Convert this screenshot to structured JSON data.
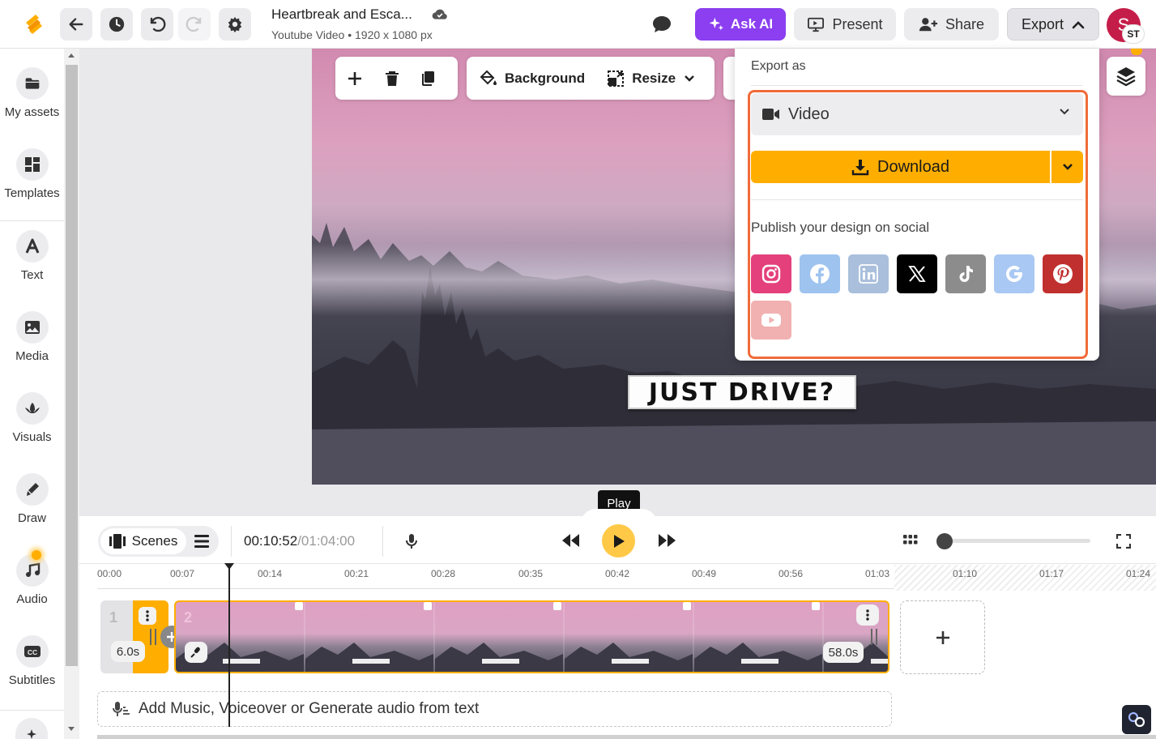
{
  "header": {
    "doc_title": "Heartbreak and Esca...",
    "doc_subtitle": "Youtube Video • 1920 x 1080 px",
    "ask_ai": "Ask AI",
    "present": "Present",
    "share": "Share",
    "export": "Export",
    "avatar_initial": "S",
    "avatar_badge": "ST"
  },
  "sidebar": {
    "items": [
      {
        "label": "My assets",
        "icon": "folder-icon"
      },
      {
        "label": "Templates",
        "icon": "templates-icon"
      },
      {
        "label": "Text",
        "icon": "text-icon"
      },
      {
        "label": "Media",
        "icon": "image-icon"
      },
      {
        "label": "Visuals",
        "icon": "visuals-icon"
      },
      {
        "label": "Draw",
        "icon": "pen-icon"
      },
      {
        "label": "Audio",
        "icon": "music-icon"
      },
      {
        "label": "Subtitles",
        "icon": "cc-icon"
      }
    ]
  },
  "toolbar": {
    "background": "Background",
    "resize": "Resize"
  },
  "canvas": {
    "caption": "JUST DRIVE?"
  },
  "export_panel": {
    "title": "Export as",
    "format": "Video",
    "download": "Download",
    "publish_title": "Publish your design on social",
    "social": [
      {
        "name": "instagram",
        "color": "#e4407b"
      },
      {
        "name": "facebook",
        "color": "#9ec3ef"
      },
      {
        "name": "linkedin",
        "color": "#a9bfdc"
      },
      {
        "name": "x",
        "color": "#000000"
      },
      {
        "name": "tiktok",
        "color": "#8c8c8c"
      },
      {
        "name": "google",
        "color": "#a9c8f3"
      },
      {
        "name": "pinterest",
        "color": "#c0302f"
      },
      {
        "name": "youtube",
        "color": "#f1b1b1"
      }
    ]
  },
  "tooltip": "Play",
  "timeline": {
    "scenes_label": "Scenes",
    "current_time": "00:10:52",
    "total_time": "/01:04:00",
    "ruler": [
      "00:00",
      "00:07",
      "00:14",
      "00:21",
      "00:28",
      "00:35",
      "00:42",
      "00:49",
      "00:56",
      "01:03",
      "01:10",
      "01:17",
      "01:24"
    ],
    "clips": [
      {
        "number": "1",
        "duration": "6.0s"
      },
      {
        "number": "2",
        "duration": "58.0s"
      }
    ],
    "audio_prompt": "Add Music, Voiceover or Generate audio from text"
  },
  "colors": {
    "accent": "#ffae00",
    "ask_ai": "#8b3ff0",
    "highlight": "#f06b3a"
  }
}
